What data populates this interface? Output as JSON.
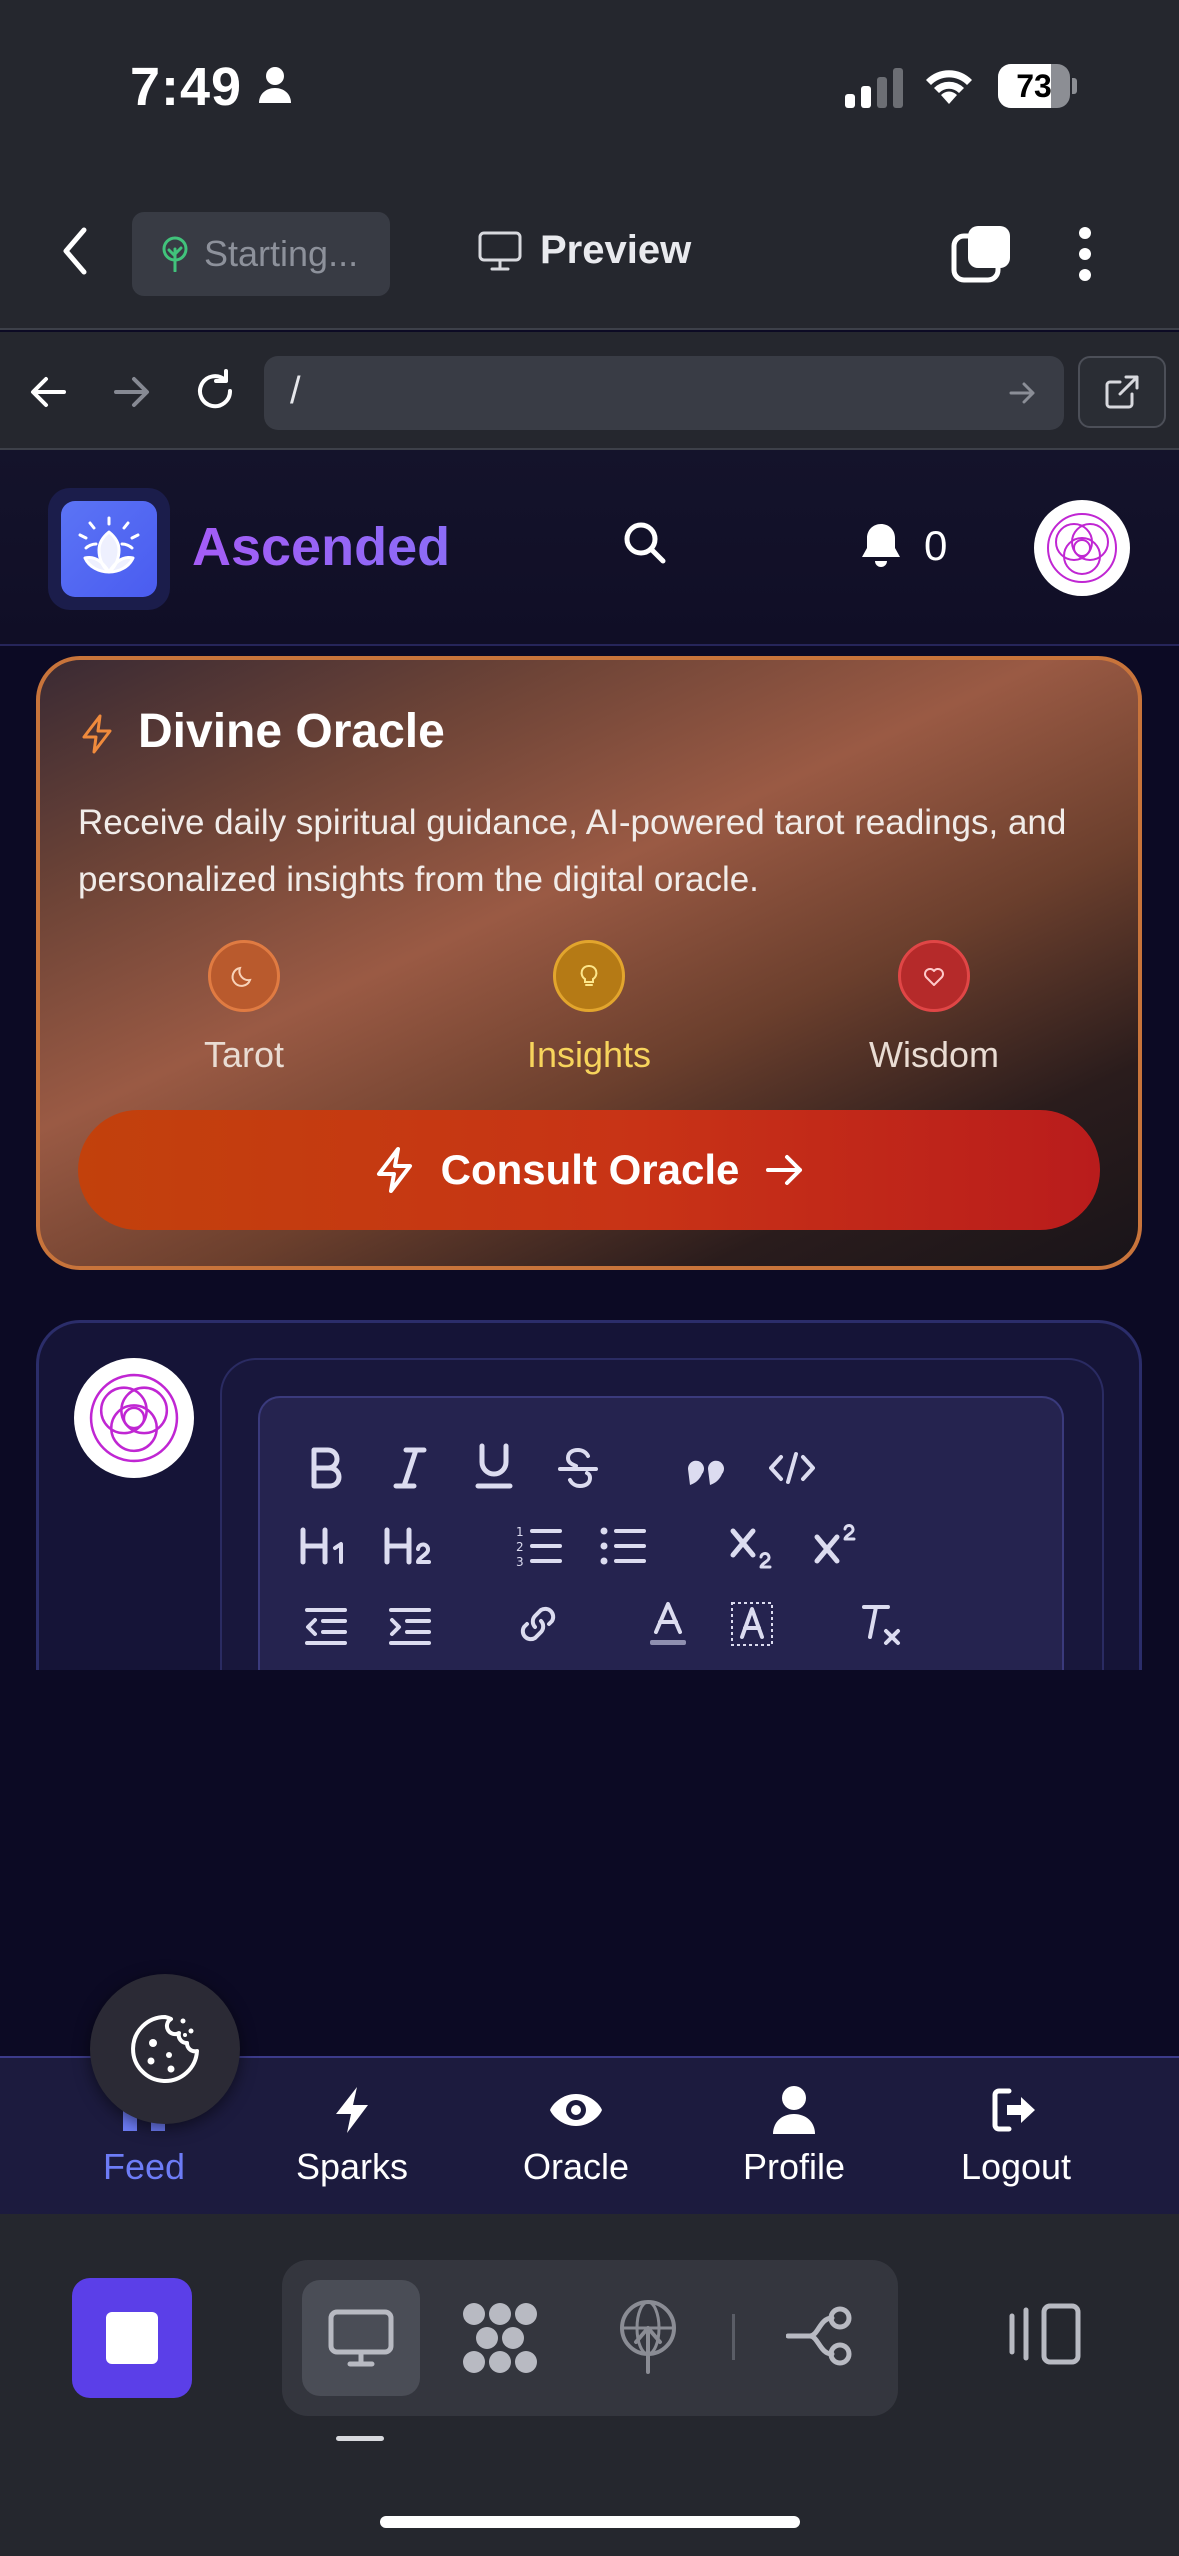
{
  "status_bar": {
    "time": "7:49",
    "battery": "73",
    "battery_level": 0.73
  },
  "app_bar": {
    "starting_label": "Starting...",
    "preview_label": "Preview"
  },
  "url_bar": {
    "url": "/"
  },
  "site": {
    "brand": "Ascended",
    "notification_count": "0"
  },
  "oracle": {
    "title": "Divine Oracle",
    "description": "Receive daily spiritual guidance, AI-powered tarot readings, and personalized insights from the digital oracle.",
    "features": [
      {
        "label": "Tarot",
        "icon": "moon-icon"
      },
      {
        "label": "Insights",
        "icon": "lightbulb-icon"
      },
      {
        "label": "Wisdom",
        "icon": "heart-icon"
      }
    ],
    "cta": "Consult Oracle"
  },
  "editor_toolbar": {
    "row1": [
      "bold",
      "italic",
      "underline",
      "strikethrough",
      "blockquote",
      "code"
    ],
    "row2": [
      "heading-1",
      "heading-2",
      "ordered-list",
      "bullet-list",
      "subscript",
      "superscript"
    ],
    "row3": [
      "outdent",
      "indent",
      "link",
      "text-color",
      "highlight",
      "clear-format"
    ]
  },
  "bottom_nav": {
    "items": [
      {
        "label": "Feed",
        "icon": "home-icon",
        "active": true
      },
      {
        "label": "Sparks",
        "icon": "bolt-icon"
      },
      {
        "label": "Oracle",
        "icon": "eye-icon"
      },
      {
        "label": "Profile",
        "icon": "user-icon"
      },
      {
        "label": "Logout",
        "icon": "logout-icon"
      }
    ]
  },
  "colors": {
    "accent": "#5b3fe8",
    "brand_gradient": [
      "#a45cf6",
      "#8b6cf7"
    ],
    "oracle_border": "#c8743b",
    "cta": "#c2410c",
    "nav_active": "#6d7cf6"
  }
}
